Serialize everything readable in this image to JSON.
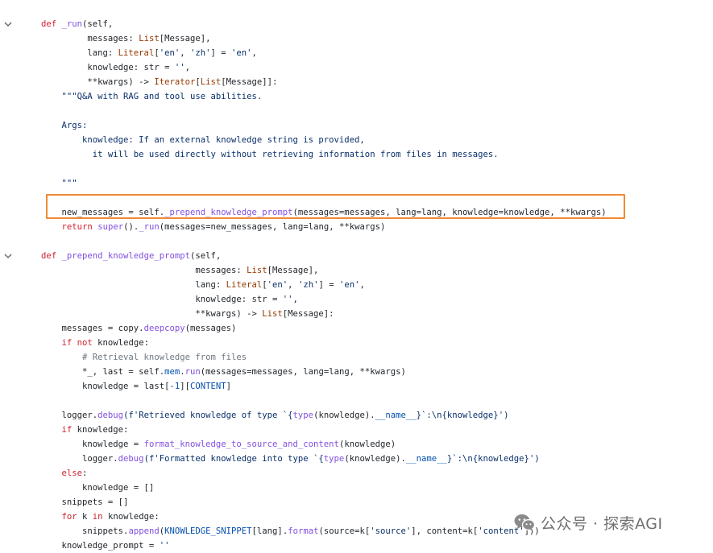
{
  "code": {
    "language": "python",
    "lines": [
      {
        "fold": true,
        "tokens": [
          {
            "t": "def ",
            "c": "kw"
          },
          {
            "t": "_run",
            "c": "fn"
          },
          {
            "t": "(self,",
            "c": "pl"
          }
        ]
      },
      {
        "tokens": [
          {
            "t": "         messages: ",
            "c": "pl"
          },
          {
            "t": "List",
            "c": "cls"
          },
          {
            "t": "[Message],",
            "c": "pl"
          }
        ]
      },
      {
        "tokens": [
          {
            "t": "         lang: ",
            "c": "pl"
          },
          {
            "t": "Literal",
            "c": "cls"
          },
          {
            "t": "[",
            "c": "pl"
          },
          {
            "t": "'en'",
            "c": "str"
          },
          {
            "t": ", ",
            "c": "pl"
          },
          {
            "t": "'zh'",
            "c": "str"
          },
          {
            "t": "] = ",
            "c": "pl"
          },
          {
            "t": "'en'",
            "c": "str"
          },
          {
            "t": ",",
            "c": "pl"
          }
        ]
      },
      {
        "tokens": [
          {
            "t": "         knowledge: str = ",
            "c": "pl"
          },
          {
            "t": "''",
            "c": "str"
          },
          {
            "t": ",",
            "c": "pl"
          }
        ]
      },
      {
        "tokens": [
          {
            "t": "         **kwargs) -> ",
            "c": "pl"
          },
          {
            "t": "Iterator",
            "c": "cls"
          },
          {
            "t": "[",
            "c": "pl"
          },
          {
            "t": "List",
            "c": "cls"
          },
          {
            "t": "[Message]]:",
            "c": "pl"
          }
        ]
      },
      {
        "tokens": [
          {
            "t": "    \"\"\"Q&A with RAG and tool use abilities.",
            "c": "doc"
          }
        ]
      },
      {
        "tokens": []
      },
      {
        "tokens": [
          {
            "t": "    Args:",
            "c": "doc"
          }
        ]
      },
      {
        "tokens": [
          {
            "t": "        knowledge: If an external knowledge string is provided,",
            "c": "doc"
          }
        ]
      },
      {
        "tokens": [
          {
            "t": "          it will be used directly without retrieving information from files in messages.",
            "c": "doc"
          }
        ]
      },
      {
        "tokens": []
      },
      {
        "tokens": [
          {
            "t": "    \"\"\"",
            "c": "doc"
          }
        ]
      },
      {
        "tokens": []
      },
      {
        "tokens": [
          {
            "t": "    new_messages = self.",
            "c": "pl"
          },
          {
            "t": "_prepend_knowledge_prompt",
            "c": "fn"
          },
          {
            "t": "(messages=messages, lang=lang, knowledge=knowledge, **kwargs)",
            "c": "pl"
          }
        ]
      },
      {
        "tokens": [
          {
            "t": "    ",
            "c": "pl"
          },
          {
            "t": "return",
            "c": "kw"
          },
          {
            "t": " ",
            "c": "pl"
          },
          {
            "t": "super",
            "c": "fn"
          },
          {
            "t": "().",
            "c": "pl"
          },
          {
            "t": "_run",
            "c": "fn"
          },
          {
            "t": "(messages=new_messages, lang=lang, **kwargs)",
            "c": "pl"
          }
        ]
      },
      {
        "tokens": []
      },
      {
        "fold": true,
        "tokens": [
          {
            "t": "def ",
            "c": "kw"
          },
          {
            "t": "_prepend_knowledge_prompt",
            "c": "fn"
          },
          {
            "t": "(self,",
            "c": "pl"
          }
        ]
      },
      {
        "tokens": [
          {
            "t": "                              messages: ",
            "c": "pl"
          },
          {
            "t": "List",
            "c": "cls"
          },
          {
            "t": "[Message],",
            "c": "pl"
          }
        ]
      },
      {
        "tokens": [
          {
            "t": "                              lang: ",
            "c": "pl"
          },
          {
            "t": "Literal",
            "c": "cls"
          },
          {
            "t": "[",
            "c": "pl"
          },
          {
            "t": "'en'",
            "c": "str"
          },
          {
            "t": ", ",
            "c": "pl"
          },
          {
            "t": "'zh'",
            "c": "str"
          },
          {
            "t": "] = ",
            "c": "pl"
          },
          {
            "t": "'en'",
            "c": "str"
          },
          {
            "t": ",",
            "c": "pl"
          }
        ]
      },
      {
        "tokens": [
          {
            "t": "                              knowledge: str = ",
            "c": "pl"
          },
          {
            "t": "''",
            "c": "str"
          },
          {
            "t": ",",
            "c": "pl"
          }
        ]
      },
      {
        "tokens": [
          {
            "t": "                              **kwargs) -> ",
            "c": "pl"
          },
          {
            "t": "List",
            "c": "cls"
          },
          {
            "t": "[Message]:",
            "c": "pl"
          }
        ]
      },
      {
        "tokens": [
          {
            "t": "    messages = copy.",
            "c": "pl"
          },
          {
            "t": "deepcopy",
            "c": "fn"
          },
          {
            "t": "(messages)",
            "c": "pl"
          }
        ]
      },
      {
        "tokens": [
          {
            "t": "    ",
            "c": "pl"
          },
          {
            "t": "if not",
            "c": "kw"
          },
          {
            "t": " knowledge:",
            "c": "pl"
          }
        ]
      },
      {
        "tokens": [
          {
            "t": "        # Retrieval knowledge from files",
            "c": "com"
          }
        ]
      },
      {
        "tokens": [
          {
            "t": "        *_, last = self.",
            "c": "pl"
          },
          {
            "t": "mem",
            "c": "attr"
          },
          {
            "t": ".",
            "c": "pl"
          },
          {
            "t": "run",
            "c": "fn"
          },
          {
            "t": "(messages=messages, lang=lang, **kwargs)",
            "c": "pl"
          }
        ]
      },
      {
        "tokens": [
          {
            "t": "        knowledge = last[",
            "c": "pl"
          },
          {
            "t": "-1",
            "c": "num"
          },
          {
            "t": "][",
            "c": "pl"
          },
          {
            "t": "CONTENT",
            "c": "attr"
          },
          {
            "t": "]",
            "c": "pl"
          }
        ]
      },
      {
        "tokens": []
      },
      {
        "tokens": [
          {
            "t": "    logger.",
            "c": "pl"
          },
          {
            "t": "debug",
            "c": "fn"
          },
          {
            "t": "(f'Retrieved knowledge of type `{",
            "c": "str"
          },
          {
            "t": "type",
            "c": "fn"
          },
          {
            "t": "(knowledge).",
            "c": "pl"
          },
          {
            "t": "__name__",
            "c": "attr"
          },
          {
            "t": "}`:\\n{knowledge}')",
            "c": "str"
          }
        ]
      },
      {
        "tokens": [
          {
            "t": "    ",
            "c": "pl"
          },
          {
            "t": "if",
            "c": "kw"
          },
          {
            "t": " knowledge:",
            "c": "pl"
          }
        ]
      },
      {
        "tokens": [
          {
            "t": "        knowledge = ",
            "c": "pl"
          },
          {
            "t": "format_knowledge_to_source_and_content",
            "c": "fn"
          },
          {
            "t": "(knowledge)",
            "c": "pl"
          }
        ]
      },
      {
        "tokens": [
          {
            "t": "        logger.",
            "c": "pl"
          },
          {
            "t": "debug",
            "c": "fn"
          },
          {
            "t": "(f'Formatted knowledge into type `{",
            "c": "str"
          },
          {
            "t": "type",
            "c": "fn"
          },
          {
            "t": "(knowledge).",
            "c": "pl"
          },
          {
            "t": "__name__",
            "c": "attr"
          },
          {
            "t": "}`:\\n{knowledge}')",
            "c": "str"
          }
        ]
      },
      {
        "tokens": [
          {
            "t": "    ",
            "c": "pl"
          },
          {
            "t": "else",
            "c": "kw"
          },
          {
            "t": ":",
            "c": "pl"
          }
        ]
      },
      {
        "tokens": [
          {
            "t": "        knowledge = []",
            "c": "pl"
          }
        ]
      },
      {
        "tokens": [
          {
            "t": "    snippets = []",
            "c": "pl"
          }
        ]
      },
      {
        "tokens": [
          {
            "t": "    ",
            "c": "pl"
          },
          {
            "t": "for",
            "c": "kw"
          },
          {
            "t": " k ",
            "c": "pl"
          },
          {
            "t": "in",
            "c": "kw"
          },
          {
            "t": " knowledge:",
            "c": "pl"
          }
        ]
      },
      {
        "tokens": [
          {
            "t": "        snippets.",
            "c": "pl"
          },
          {
            "t": "append",
            "c": "fn"
          },
          {
            "t": "(",
            "c": "pl"
          },
          {
            "t": "KNOWLEDGE_SNIPPET",
            "c": "attr"
          },
          {
            "t": "[lang].",
            "c": "pl"
          },
          {
            "t": "format",
            "c": "fn"
          },
          {
            "t": "(source=k[",
            "c": "pl"
          },
          {
            "t": "'source'",
            "c": "str"
          },
          {
            "t": "], content=k[",
            "c": "pl"
          },
          {
            "t": "'content'",
            "c": "str"
          },
          {
            "t": "]))",
            "c": "pl"
          }
        ]
      },
      {
        "tokens": [
          {
            "t": "    knowledge_prompt = ",
            "c": "pl"
          },
          {
            "t": "''",
            "c": "str"
          }
        ]
      }
    ]
  },
  "highlight_color": "#f08a33",
  "watermark": {
    "icon": "wechat-logo-icon",
    "text": "公众号 · 探索AGI"
  }
}
